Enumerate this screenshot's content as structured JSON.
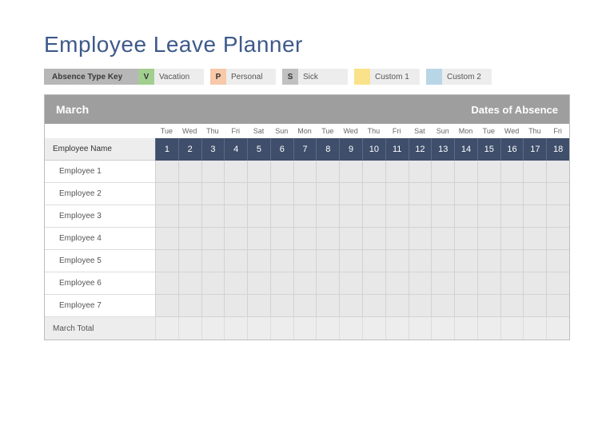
{
  "title": "Employee Leave Planner",
  "legend": {
    "key_label": "Absence Type Key",
    "items": [
      {
        "code": "V",
        "label": "Vacation"
      },
      {
        "code": "P",
        "label": "Personal"
      },
      {
        "code": "S",
        "label": "Sick"
      },
      {
        "code": "",
        "label": "Custom 1"
      },
      {
        "code": "",
        "label": "Custom 2"
      }
    ]
  },
  "planner": {
    "month": "March",
    "dates_label": "Dates of Absence",
    "name_header": "Employee Name",
    "total_label": "March Total",
    "days_of_week": [
      "Tue",
      "Wed",
      "Thu",
      "Fri",
      "Sat",
      "Sun",
      "Mon",
      "Tue",
      "Wed",
      "Thu",
      "Fri",
      "Sat",
      "Sun",
      "Mon",
      "Tue",
      "Wed",
      "Thu",
      "Fri"
    ],
    "dates": [
      1,
      2,
      3,
      4,
      5,
      6,
      7,
      8,
      9,
      10,
      11,
      12,
      13,
      14,
      15,
      16,
      17,
      18
    ],
    "employees": [
      "Employee 1",
      "Employee 2",
      "Employee 3",
      "Employee 4",
      "Employee 5",
      "Employee 6",
      "Employee 7"
    ]
  }
}
